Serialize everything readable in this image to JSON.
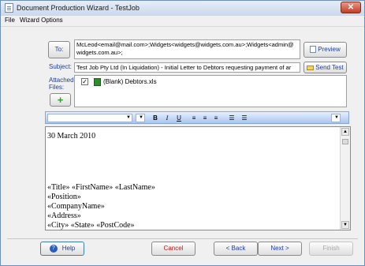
{
  "window": {
    "title": "Document Production Wizard - TestJob",
    "close_glyph": "✕"
  },
  "menu": {
    "items": [
      "File",
      "Wizard Options"
    ]
  },
  "form": {
    "to_button": "To:",
    "to_value": "McLeod<email@mail.com>;Widgets<widgets@widgets.com.au>;Widgets<admin@widgets.com.au>;",
    "preview_button": "Preview",
    "subject_label": "Subject:",
    "subject_value": "Test Job Pty Ltd (In Liquidation) - Initial Letter to Debtors requesting payment of ar",
    "send_test_button": "Send Test",
    "attached_label": "Attached Files:",
    "attachment_name": "(Blank) Debtors.xls",
    "add_button": "+"
  },
  "toolbar": {
    "bold": "B",
    "italic": "I",
    "underline": "U"
  },
  "editor": {
    "date": "30 March 2010",
    "lines": [
      "«Title» «FirstName» «LastName»",
      "«Position»",
      "«CompanyName»",
      "«Address»",
      "«City» «State» «PostCode»"
    ]
  },
  "footer": {
    "help_button": "Help",
    "cancel_button": "Cancel",
    "back_button": "< Back",
    "next_button": "Next >",
    "finish_button": "Finish"
  },
  "colors": {
    "accent_blue": "#1e3e9a",
    "cancel_red": "#c01616",
    "toolbar": "#a9c6f0"
  }
}
